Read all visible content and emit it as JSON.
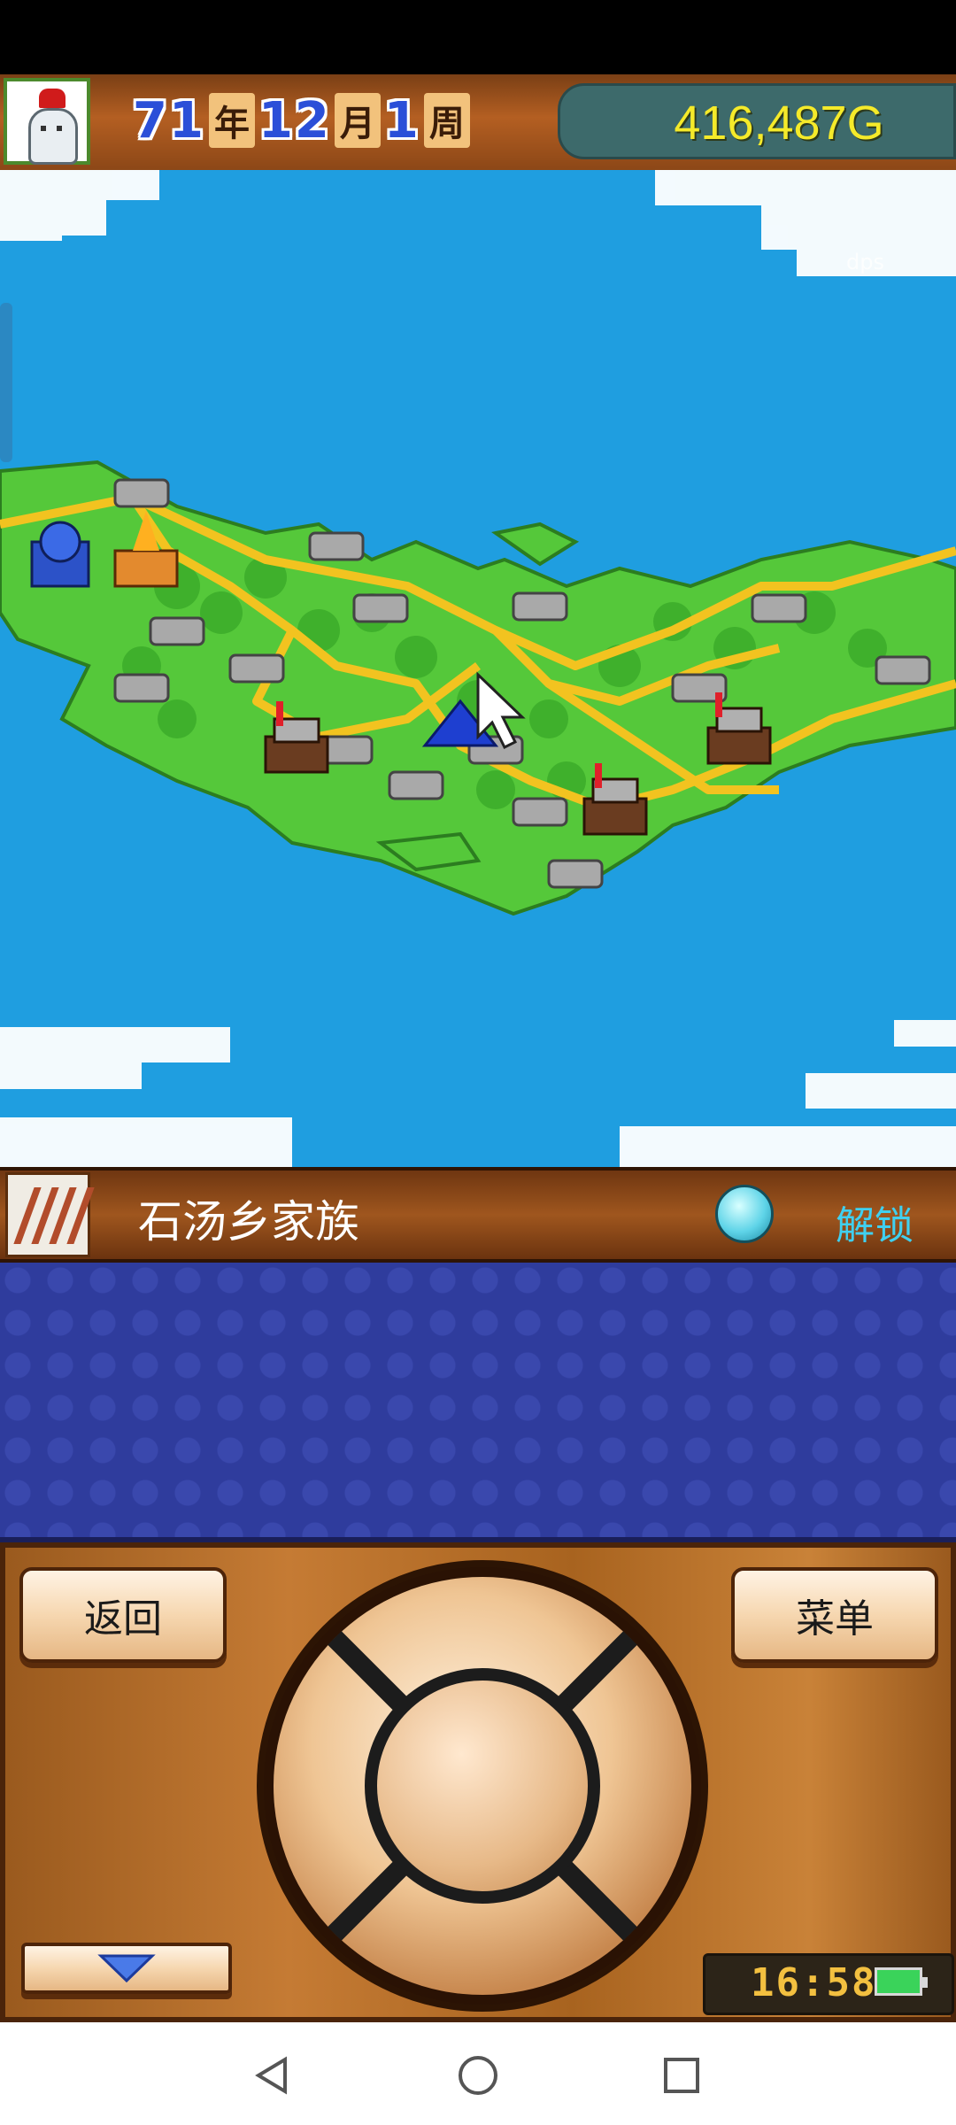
{
  "header": {
    "year_num": "71",
    "year_unit": "年",
    "month_num": "12",
    "month_unit": "月",
    "week_num": "1",
    "week_unit": "周",
    "money": "416,487G"
  },
  "map": {
    "watermark": "dps"
  },
  "info_bar": {
    "family_name": "石汤乡家族",
    "unlock_label": "解锁"
  },
  "controls": {
    "back_label": "返回",
    "menu_label": "菜单",
    "clock": "16:58"
  },
  "icons": {
    "avatar": "snowman-avatar-icon",
    "unlock_orb": "orb-icon",
    "collapse": "chevron-down-icon",
    "battery": "battery-icon",
    "nav_back": "back-triangle-icon",
    "nav_home": "home-circle-icon",
    "nav_recent": "recent-square-icon"
  },
  "colors": {
    "money": "#f5ea2a",
    "unlock": "#3fd0f0",
    "sea": "#1f9ee0",
    "land": "#55c83a",
    "road": "#f2c320"
  }
}
